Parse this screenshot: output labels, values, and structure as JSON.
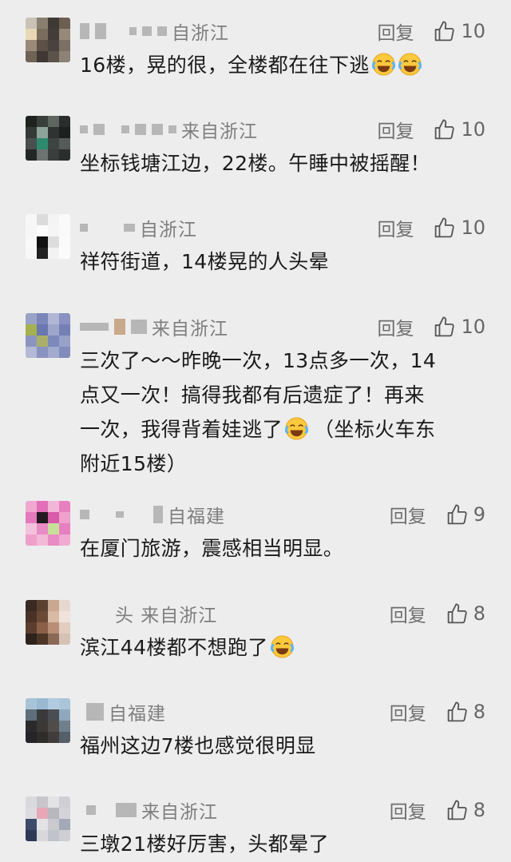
{
  "colors": {
    "background": "#ededed",
    "text": "#1a1a1a",
    "meta": "#7e7e7e"
  },
  "comments": [
    {
      "location": "自浙江",
      "reply_label": "回复",
      "likes": "10",
      "text": "16楼，晃的很，全楼都在往下逃",
      "emoji": "laughing-crying-emoji",
      "emoji_count": 2
    },
    {
      "location": "来自浙江",
      "reply_label": "回复",
      "likes": "10",
      "text": "坐标钱塘江边，22楼。午睡中被摇醒！"
    },
    {
      "location": "自浙江",
      "reply_label": "回复",
      "likes": "10",
      "text": "祥符街道，14楼晃的人头晕"
    },
    {
      "location": "来自浙江",
      "reply_label": "回复",
      "likes": "10",
      "text_lines": [
        "三次了～～昨晚一次，13点多一次，14",
        "点又一次！搞得我都有后遗症了！再来",
        "一次，我得背着娃逃了",
        "附近15楼）"
      ],
      "line3_after": "（坐标火车东",
      "emoji": "laughing-crying-emoji",
      "emoji_count": 1
    },
    {
      "location": "自福建",
      "reply_label": "回复",
      "likes": "9",
      "text": "在厦门旅游，震感相当明显。"
    },
    {
      "location": "头 来自浙江",
      "reply_label": "回复",
      "likes": "8",
      "text": "滨江44楼都不想跑了",
      "emoji": "laughing-crying-emoji",
      "emoji_count": 1
    },
    {
      "location": "自福建",
      "reply_label": "回复",
      "likes": "8",
      "text": "福州这边7楼也感觉很明显"
    },
    {
      "location": "来自浙江",
      "reply_label": "回复",
      "likes": "8",
      "text": "三墩21楼好厉害，头都晕了"
    }
  ]
}
